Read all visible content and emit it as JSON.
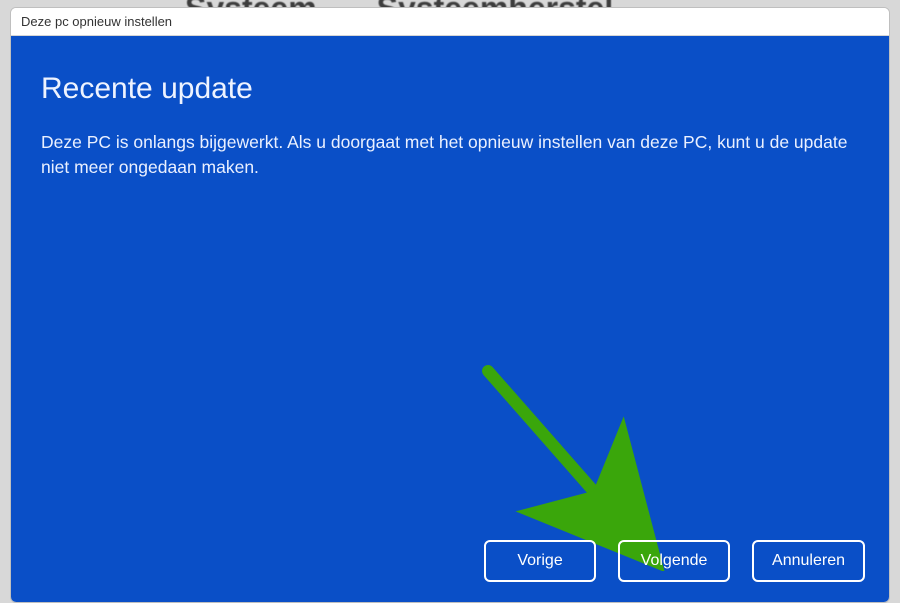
{
  "background": {
    "word1": "Systeem",
    "word2": "Systeemherstel"
  },
  "window": {
    "title": "Deze pc opnieuw instellen"
  },
  "dialog": {
    "heading": "Recente update",
    "body": "Deze PC is onlangs bijgewerkt. Als u doorgaat met het opnieuw instellen van deze PC, kunt u de update niet meer ongedaan maken."
  },
  "buttons": {
    "previous": "Vorige",
    "next": "Volgende",
    "cancel": "Annuleren"
  },
  "colors": {
    "accent": "#0a4fc7",
    "arrow": "#3aa60b"
  }
}
